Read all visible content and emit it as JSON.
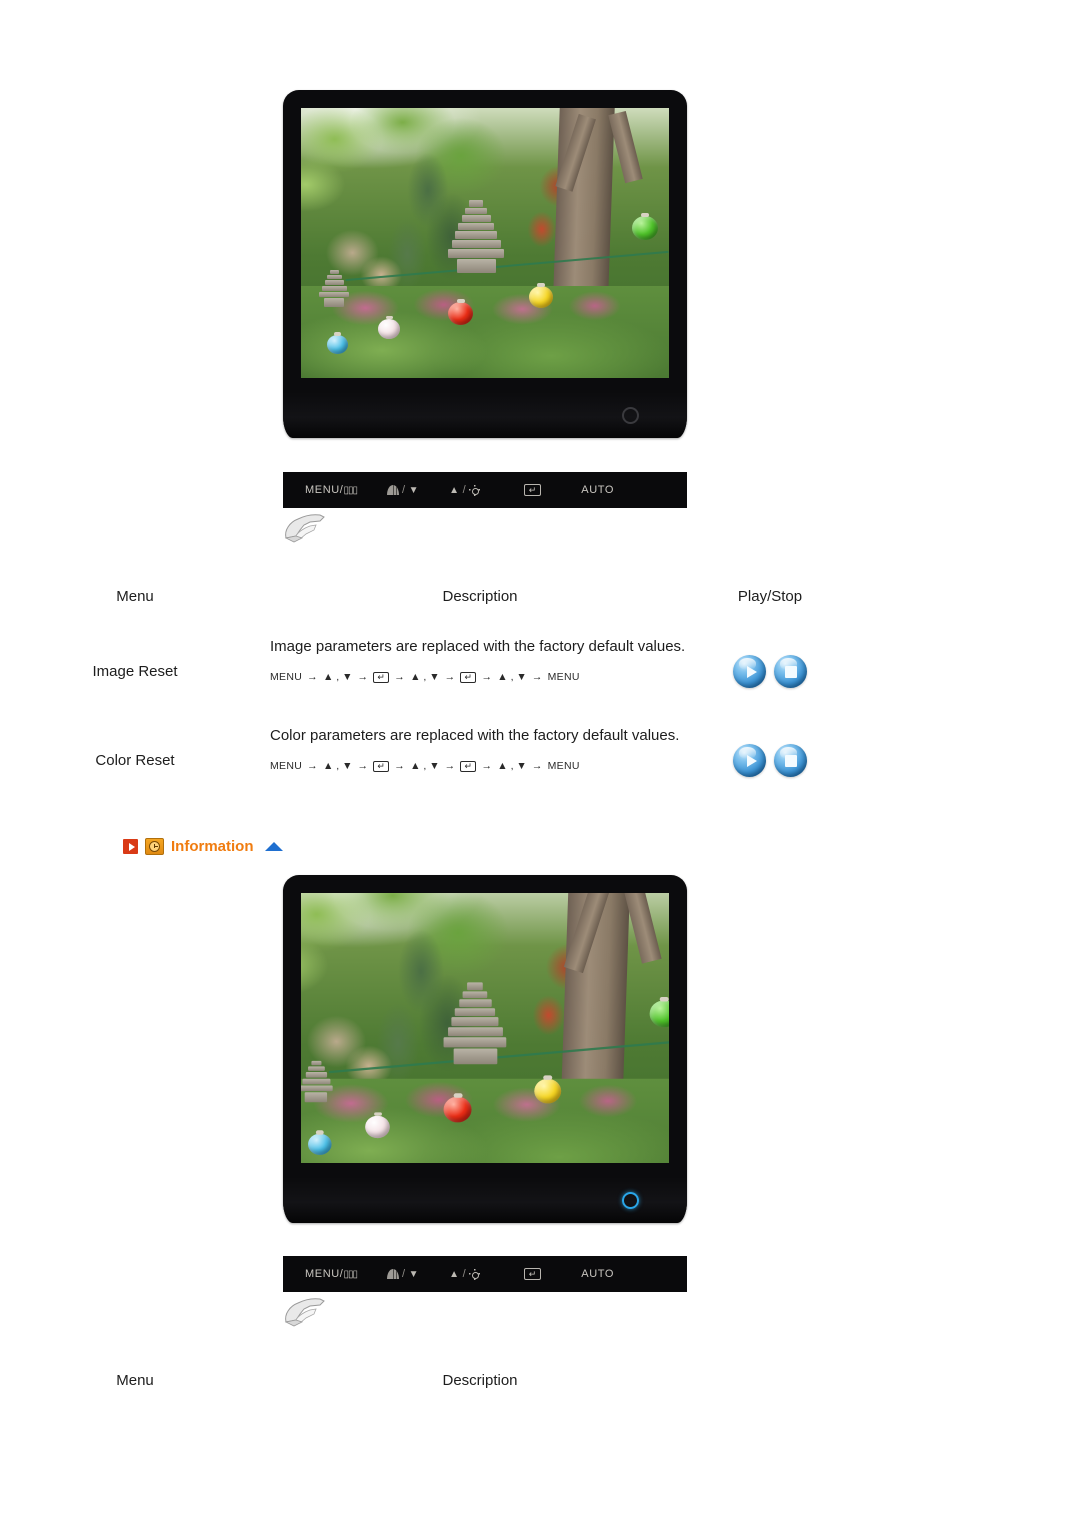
{
  "monitors": [
    {
      "name": "monitor-top",
      "power_led": "off",
      "screen_image": "korean-garden-stone-pagoda-lanterns"
    },
    {
      "name": "monitor-bottom",
      "power_led": "on",
      "screen_image": "korean-garden-stone-pagoda-lanterns"
    }
  ],
  "button_bar": {
    "menu_label": "MENU/",
    "menu_box_glyph": "▯▯▯",
    "contrast_icon": "contrast-icon",
    "contrast_separator": "/",
    "down_arrow": "▼",
    "up_arrow": "▲",
    "brightness_separator": "/",
    "brightness_icon": "sun-icon",
    "enter_glyph": "↵",
    "auto_label": "AUTO"
  },
  "table_reset": {
    "headers": {
      "menu": "Menu",
      "description": "Description",
      "play_stop": "Play/Stop"
    },
    "rows": [
      {
        "menu": "Image Reset",
        "description": "Image parameters are replaced with the factory default values.",
        "keypath": [
          "MENU",
          "→",
          "▲ , ▼",
          "→",
          "↵",
          "→",
          "▲ , ▼",
          "→",
          "↵",
          "→",
          "▲ , ▼",
          "→",
          "MENU"
        ],
        "play_label": "play-button",
        "stop_label": "stop-button"
      },
      {
        "menu": "Color Reset",
        "description": "Color parameters are replaced with the factory default values.",
        "keypath": [
          "MENU",
          "→",
          "▲ , ▼",
          "→",
          "↵",
          "→",
          "▲ , ▼",
          "→",
          "↵",
          "→",
          "▲ , ▼",
          "→",
          "MENU"
        ],
        "play_label": "play-button",
        "stop_label": "stop-button"
      }
    ]
  },
  "information_section": {
    "title": "Information",
    "play_icon": "play-square-icon",
    "clock_icon": "clock-icon",
    "collapse_icon": "triangle-up-icon"
  },
  "table_information": {
    "headers": {
      "menu": "Menu",
      "description": "Description"
    }
  },
  "colors": {
    "information_title": "#f07c10",
    "play_square": "#d93a16",
    "clock": "#f5a623",
    "triangle_up": "#1f6fd0",
    "orb_blue": "#3a92d4",
    "led_on": "#2aa6e8",
    "bezel": "#0b0b0d",
    "button_bar_bg": "#0a0a0c"
  }
}
